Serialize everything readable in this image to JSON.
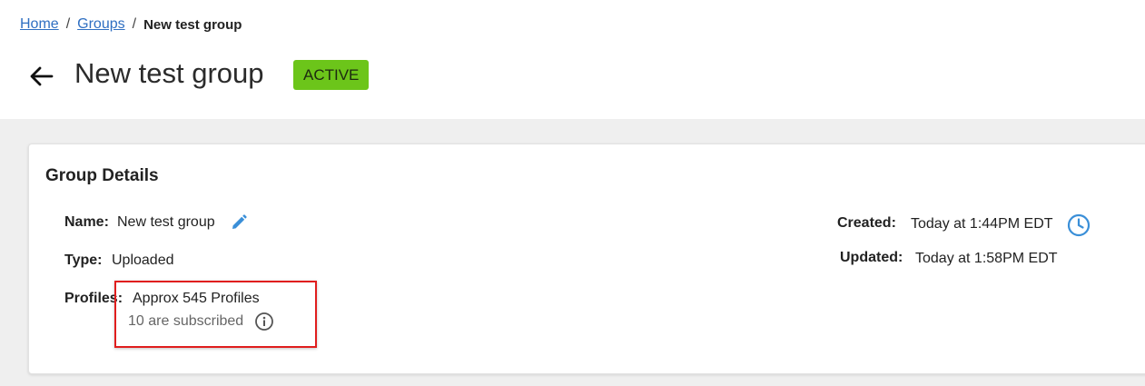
{
  "breadcrumb": {
    "home": "Home",
    "groups": "Groups",
    "separator": "/",
    "current": "New test group"
  },
  "header": {
    "title": "New test group",
    "status": "ACTIVE",
    "back_icon": "arrow-left-icon"
  },
  "details": {
    "title": "Group Details",
    "name_label": "Name:",
    "name_value": "New test group",
    "edit_icon": "pencil-icon",
    "type_label": "Type:",
    "type_value": "Uploaded",
    "profiles_label": "Profiles:",
    "profiles_value": "Approx 545 Profiles",
    "subscribed_text": "10 are subscribed",
    "info_icon": "info-icon",
    "created_label": "Created:",
    "created_value": "Today at 1:44PM EDT",
    "clock_icon": "clock-icon",
    "updated_label": "Updated:",
    "updated_value": "Today at 1:58PM EDT"
  },
  "colors": {
    "link": "#2f6fc2",
    "badge_bg": "#6cc51a",
    "highlight": "#e01e1e",
    "icon_blue": "#3a8fd8"
  }
}
